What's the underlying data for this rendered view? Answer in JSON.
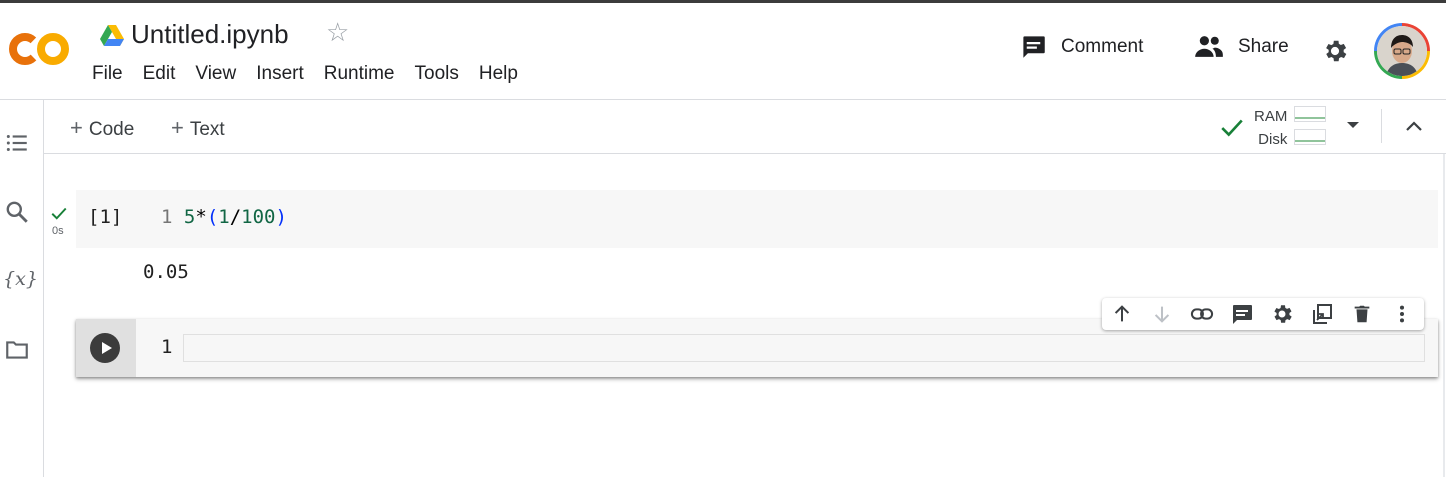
{
  "header": {
    "title": "Untitled.ipynb",
    "menu": [
      "File",
      "Edit",
      "View",
      "Insert",
      "Runtime",
      "Tools",
      "Help"
    ],
    "comment_label": "Comment",
    "share_label": "Share"
  },
  "toolbar": {
    "add_code_label": "Code",
    "add_text_label": "Text",
    "ram_label": "RAM",
    "disk_label": "Disk"
  },
  "cells": [
    {
      "type": "code",
      "exec_count": "[1]",
      "line_number": "1",
      "code": "5*(1/100)",
      "run_time": "0s",
      "output": "0.05"
    },
    {
      "type": "code",
      "line_number": "1",
      "code": ""
    }
  ],
  "icons": {
    "logo": "colab-logo",
    "drive": "drive-icon",
    "star": "star-icon",
    "comment": "comment-icon",
    "share": "people-icon",
    "settings": "gear-icon",
    "sidebar": [
      "toc-icon",
      "search-icon",
      "variables-icon",
      "folder-icon"
    ],
    "cell_toolbar": [
      "arrow-up-icon",
      "arrow-down-icon",
      "link-icon",
      "comment-icon",
      "gear-icon",
      "mirror-cell-icon",
      "trash-icon",
      "more-vert-icon"
    ]
  },
  "colors": {
    "logo_orange": "#f9ab00",
    "check_green": "#188038",
    "code_number": "#116644",
    "code_paren": "#0431fa"
  }
}
